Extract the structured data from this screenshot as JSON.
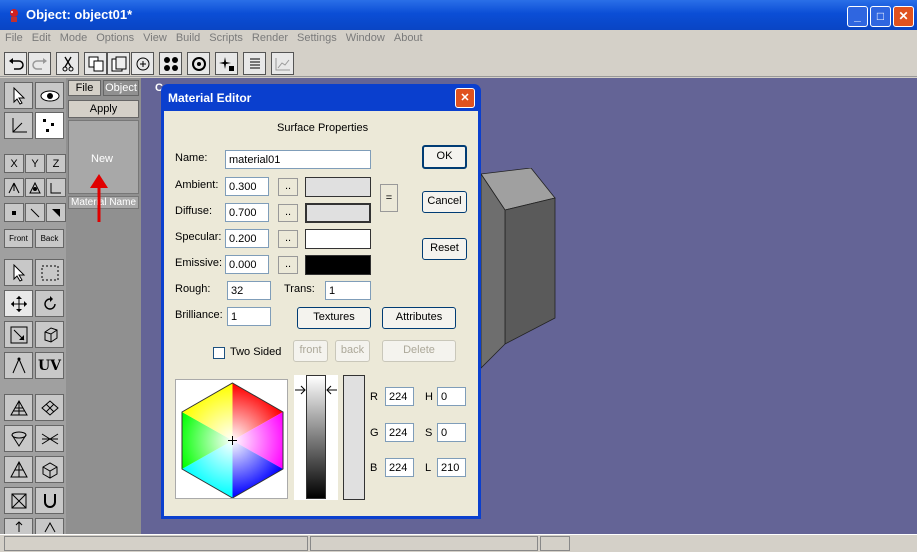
{
  "window": {
    "title": "Object: object01*",
    "minimize": "_",
    "maximize": "□",
    "close": "✕"
  },
  "menu": [
    "File",
    "Edit",
    "Mode",
    "Options",
    "View",
    "Build",
    "Scripts",
    "Render",
    "Settings",
    "Window",
    "About"
  ],
  "left_tools": {
    "x": "X",
    "y": "Y",
    "z": "Z",
    "front": "Front",
    "back": "Back",
    "uv": "UV"
  },
  "material_panel": {
    "tab_file": "File",
    "tab_object": "Object",
    "apply": "Apply",
    "new": "New",
    "header": "Material Name"
  },
  "viewport": {
    "label": "C"
  },
  "dialog": {
    "title": "Material Editor",
    "close": "✕",
    "section": "Surface Properties",
    "name_label": "Name:",
    "name_value": "material01",
    "ambient_label": "Ambient:",
    "ambient_value": "0.300",
    "diffuse_label": "Diffuse:",
    "diffuse_value": "0.700",
    "specular_label": "Specular:",
    "specular_value": "0.200",
    "emissive_label": "Emissive:",
    "emissive_value": "0.000",
    "dot_btn": "..",
    "equal_btn": "=",
    "rough_label": "Rough:",
    "rough_value": "32",
    "trans_label": "Trans:",
    "trans_value": "1",
    "brilliance_label": "Brilliance:",
    "brilliance_value": "1",
    "textures": "Textures",
    "attributes": "Attributes",
    "ok": "OK",
    "cancel": "Cancel",
    "reset": "Reset",
    "two_sided": "Two Sided",
    "front": "front",
    "back": "back",
    "delete": "Delete",
    "r_label": "R",
    "r_value": "224",
    "g_label": "G",
    "g_value": "224",
    "b_label": "B",
    "b_value": "224",
    "h_label": "H",
    "h_value": "0",
    "s_label": "S",
    "s_value": "0",
    "l_label": "L",
    "l_value": "210"
  },
  "colors": {
    "ambient": "#e0e0e0",
    "diffuse": "#e0e0e0",
    "specular": "#ffffff",
    "emissive": "#000000",
    "viewport": "#646496",
    "cube_front": "#6e6e6e",
    "cube_side": "#5a5a5a",
    "cube_top": "#a0a0a0"
  }
}
